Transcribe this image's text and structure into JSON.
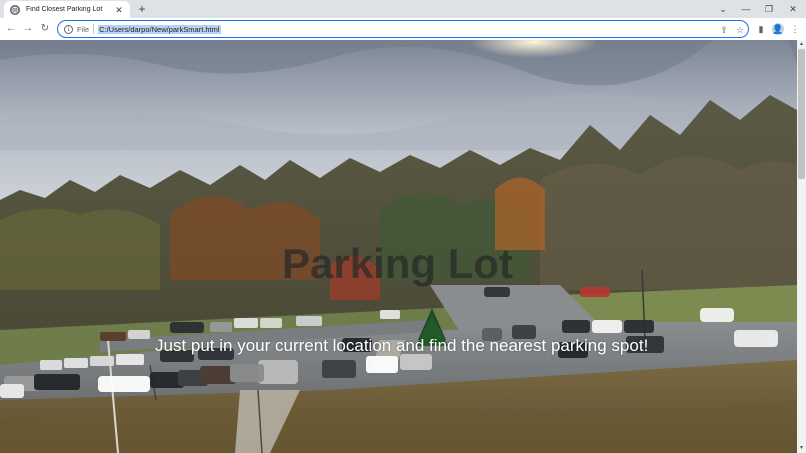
{
  "browser": {
    "tab": {
      "title": "Find Closest Parking Lot",
      "favicon": "globe-icon"
    },
    "address_bar": {
      "scheme_label": "File",
      "url": "C:/Users/darpo/New/parkSmart.html"
    }
  },
  "page": {
    "title": "Parking Lot",
    "subtitle": "Just put in your current location and find the nearest parking spot!",
    "background": "parking-lot-photo"
  },
  "colors": {
    "focus_ring": "#1a73e8",
    "url_highlight": "#b9d1f5",
    "chrome_bg": "#dee1e6"
  }
}
